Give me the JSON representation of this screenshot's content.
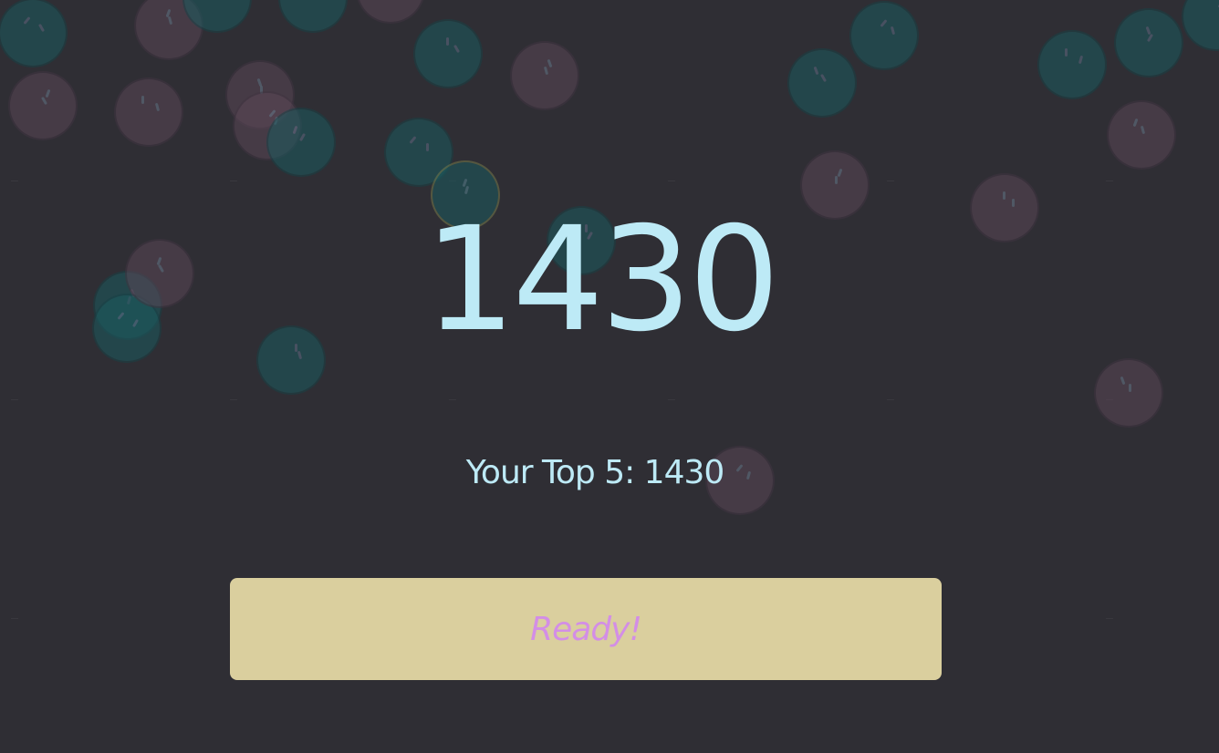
{
  "game": {
    "score": "1430",
    "top5_text": "Your Top 5: 1430",
    "ready_label": "Ready!"
  },
  "colors": {
    "background": "#2f2e34",
    "score_text": "#bdeaf6",
    "button_bg": "#dacf9e",
    "button_text": "#d38ee6",
    "bubble_teal": "#1b5a5e",
    "bubble_mauve": "#5a4656"
  }
}
